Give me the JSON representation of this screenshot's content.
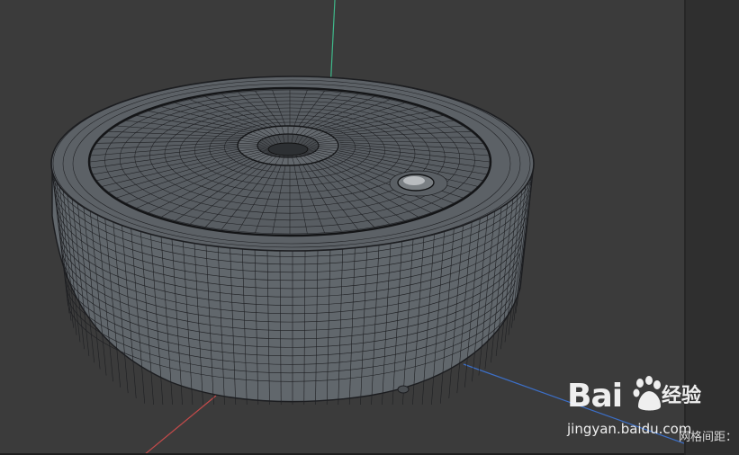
{
  "viewport": {
    "background": "#3b3b3b",
    "axis_colors": {
      "y": "#3fb88a",
      "x": "#c24a4a",
      "z": "#3c6fc7"
    },
    "object": "mesh-cylinder",
    "mesh_colors": {
      "fill": "#5f6469",
      "lines": "#1e1f22"
    }
  },
  "status": {
    "grid_spacing_label": "网格间距："
  },
  "watermark": {
    "brand": "Bai",
    "brand_suffix": "du",
    "product": "经验",
    "url": "jingyan.baidu.com"
  }
}
